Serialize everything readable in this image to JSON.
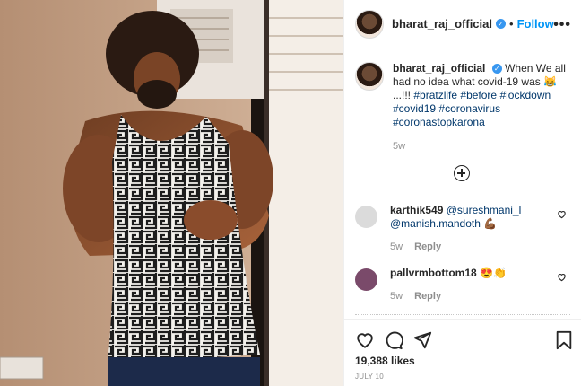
{
  "post": {
    "username": "bharat_raj_official",
    "verified_icon": "verified-badge-icon",
    "separator": "•",
    "follow_label": "Follow",
    "more_icon": "more-options-icon"
  },
  "caption": {
    "username": "bharat_raj_official",
    "text": "When We all had no idea what covid-19 was",
    "emoji": "😹",
    "exclaim": "...!!!",
    "hashtags": [
      "#bratzlife",
      "#before",
      "#lockdown",
      "#covid19",
      "#coronavirus",
      "#coronastopkarona"
    ],
    "time": "5w"
  },
  "load_more_icon": "plus-circle-icon",
  "comments": [
    {
      "username": "karthik549",
      "mentions": [
        "@sureshmani_l",
        "@manish.mandoth"
      ],
      "emoji": "💪🏾",
      "time": "5w",
      "reply_label": "Reply",
      "avatar_color": "#dbdbdb"
    },
    {
      "username": "pallvrmbottom18",
      "emoji": "😍👏",
      "time": "5w",
      "reply_label": "Reply",
      "avatar_color": "#7a4a6a"
    }
  ],
  "actions": {
    "like_icon": "heart-icon",
    "comment_icon": "comment-icon",
    "share_icon": "share-icon",
    "save_icon": "bookmark-icon"
  },
  "likes_text": "19,388 likes",
  "date_text": "JULY 10",
  "colors": {
    "follow": "#0095f6",
    "hashtag": "#00376b",
    "muted": "#8e8e8e",
    "verified": "#3897f0"
  }
}
